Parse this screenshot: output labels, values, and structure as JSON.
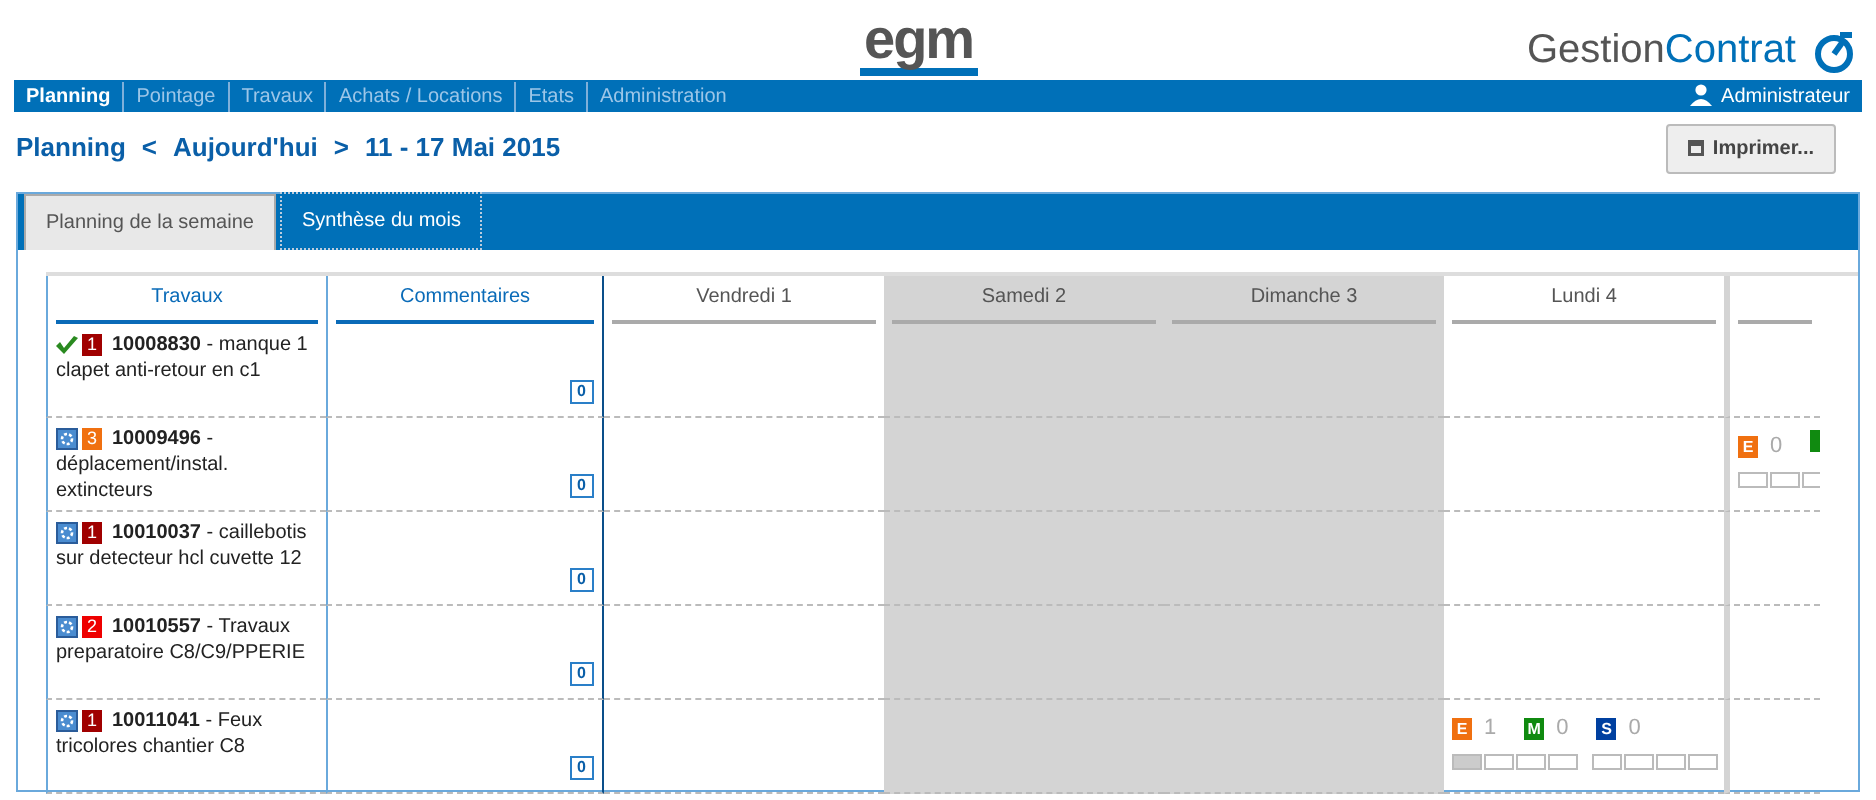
{
  "header": {
    "logo": "egm",
    "app_name_parts": [
      "Gestion",
      "Contrat"
    ]
  },
  "nav": {
    "items": [
      {
        "label": "Planning",
        "selected": true
      },
      {
        "label": "Pointage",
        "selected": false
      },
      {
        "label": "Travaux",
        "selected": false
      },
      {
        "label": "Achats / Locations",
        "selected": false
      },
      {
        "label": "Etats",
        "selected": false
      },
      {
        "label": "Administration",
        "selected": false
      }
    ],
    "user": "Administrateur"
  },
  "toolbar": {
    "title": "Planning",
    "prev": "<",
    "today": "Aujourd'hui",
    "next": ">",
    "range": "11 - 17 Mai 2015",
    "print_button": "Imprimer..."
  },
  "tabs": [
    {
      "label": "Planning de la semaine",
      "selected": false
    },
    {
      "label": "Synthèse du mois",
      "selected": true
    }
  ],
  "table": {
    "columns": [
      {
        "label": "Travaux",
        "kind": "fixed"
      },
      {
        "label": "Commentaires",
        "kind": "fixed"
      },
      {
        "label": "Vendredi 1",
        "kind": "day",
        "weekend": false
      },
      {
        "label": "Samedi 2",
        "kind": "day",
        "weekend": true
      },
      {
        "label": "Dimanche 3",
        "kind": "day",
        "weekend": true
      },
      {
        "label": "Lundi 4",
        "kind": "day",
        "weekend": false
      },
      {
        "kind": "day",
        "weekend": false
      }
    ],
    "rows": [
      {
        "kind": "check",
        "priority": {
          "label": "1",
          "color": "#a00000"
        },
        "number": "10008830",
        "description": " - manque 1 clapet anti-retour en c1",
        "comments": "0",
        "days": [
          {
            "weekend": false
          },
          {
            "weekend": true
          },
          {
            "weekend": true
          },
          {
            "weekend": false
          },
          {
            "weekend": false
          }
        ]
      },
      {
        "kind": "task",
        "priority": {
          "label": "3",
          "color": "#f07010"
        },
        "number": "10009496",
        "description": " - déplacement/instal. extincteurs",
        "comments": "0",
        "days": [
          {
            "weekend": false
          },
          {
            "weekend": true
          },
          {
            "weekend": true
          },
          {
            "weekend": false
          },
          {
            "weekend": false,
            "shifts": [
              {
                "letter": "E",
                "color": "#f07010",
                "count": "0"
              },
              {
                "color": "#108a10"
              }
            ],
            "slots": [
              [
                false,
                false,
                false
              ]
            ]
          }
        ]
      },
      {
        "kind": "task",
        "priority": {
          "label": "1",
          "color": "#a00000"
        },
        "number": "10010037",
        "description": " - caillebotis sur detecteur hcl cuvette 12",
        "comments": "0",
        "days": [
          {
            "weekend": false
          },
          {
            "weekend": true
          },
          {
            "weekend": true
          },
          {
            "weekend": false
          },
          {
            "weekend": false
          }
        ]
      },
      {
        "kind": "task",
        "priority": {
          "label": "2",
          "color": "#ee0000"
        },
        "number": "10010557",
        "description": " - Travaux preparatoire C8/C9/PPERIE",
        "comments": "0",
        "days": [
          {
            "weekend": false
          },
          {
            "weekend": true
          },
          {
            "weekend": true
          },
          {
            "weekend": false
          },
          {
            "weekend": false
          }
        ]
      },
      {
        "kind": "task",
        "priority": {
          "label": "1",
          "color": "#a00000"
        },
        "number": "10011041",
        "description": " - Feux tricolores chantier C8",
        "comments": "0",
        "days": [
          {
            "weekend": false
          },
          {
            "weekend": true
          },
          {
            "weekend": true
          },
          {
            "weekend": false,
            "shifts": [
              {
                "letter": "E",
                "color": "#f07010",
                "count": "1"
              },
              {
                "letter": "M",
                "color": "#108a10",
                "count": "0"
              },
              {
                "letter": "S",
                "color": "#0040a0",
                "count": "0"
              }
            ],
            "slots": [
              [
                true,
                false,
                false,
                false
              ],
              [
                false,
                false,
                false,
                false
              ]
            ]
          },
          {
            "weekend": false
          }
        ]
      }
    ]
  }
}
